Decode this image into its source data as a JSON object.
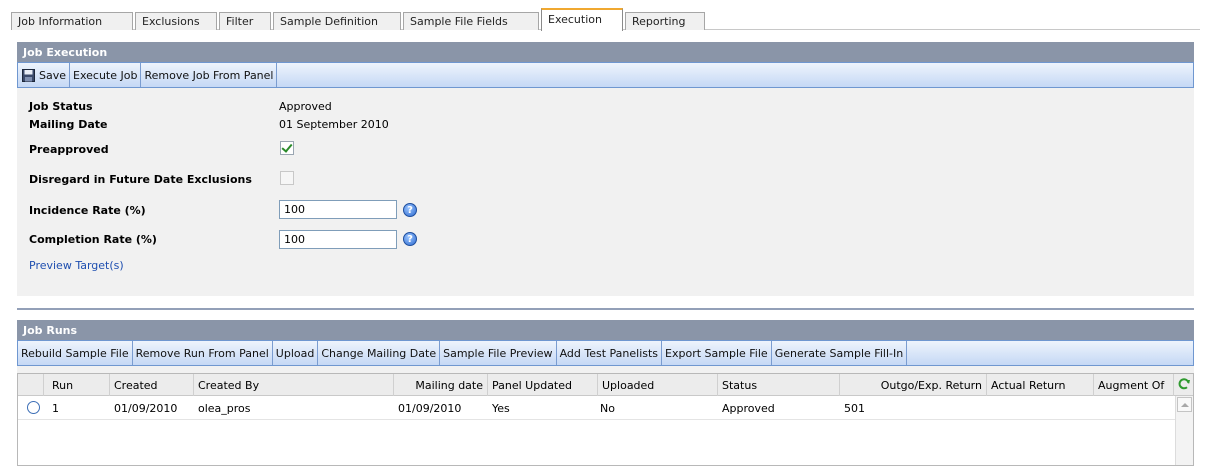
{
  "tabs": [
    {
      "label": "Job Information"
    },
    {
      "label": "Exclusions"
    },
    {
      "label": "Filter"
    },
    {
      "label": "Sample Definition"
    },
    {
      "label": "Sample File Fields"
    },
    {
      "label": "Execution",
      "active": true
    },
    {
      "label": "Reporting"
    }
  ],
  "job_execution": {
    "title": "Job Execution",
    "toolbar": {
      "save": "Save",
      "execute": "Execute Job",
      "remove": "Remove Job From Panel"
    },
    "fields": {
      "job_status_label": "Job Status",
      "job_status_value": "Approved",
      "mailing_date_label": "Mailing Date",
      "mailing_date_value": "01 September 2010",
      "preapproved_label": "Preapproved",
      "preapproved_checked": true,
      "disregard_label": "Disregard in Future Date Exclusions",
      "disregard_checked": false,
      "incidence_label": "Incidence Rate (%)",
      "incidence_value": "100",
      "completion_label": "Completion Rate (%)",
      "completion_value": "100"
    },
    "preview_link": "Preview Target(s)"
  },
  "job_runs": {
    "title": "Job Runs",
    "toolbar": {
      "rebuild": "Rebuild Sample File",
      "remove_run": "Remove Run From Panel",
      "upload": "Upload",
      "change_date": "Change Mailing Date",
      "preview": "Sample File Preview",
      "add_test": "Add Test Panelists",
      "export": "Export Sample File",
      "generate": "Generate Sample Fill-In"
    },
    "columns": [
      "Run",
      "Created",
      "Created By",
      "Mailing date",
      "Panel Updated",
      "Uploaded",
      "Status",
      "Outgo/Exp. Return",
      "Actual Return",
      "Augment Of"
    ],
    "rows": [
      {
        "run": "1",
        "created": "01/09/2010",
        "created_by": "olea_pros",
        "mailing_date": "01/09/2010",
        "panel_updated": "Yes",
        "uploaded": "No",
        "status": "Approved",
        "outgo": "501",
        "actual": "",
        "augment": ""
      }
    ]
  },
  "colors": {
    "header": "#8a95a8",
    "toolbar_border": "#6f97d0",
    "active_tab": "#f0a830",
    "link": "#1f4fb0"
  },
  "icons": [
    "save-icon",
    "help-icon",
    "refresh-icon"
  ]
}
